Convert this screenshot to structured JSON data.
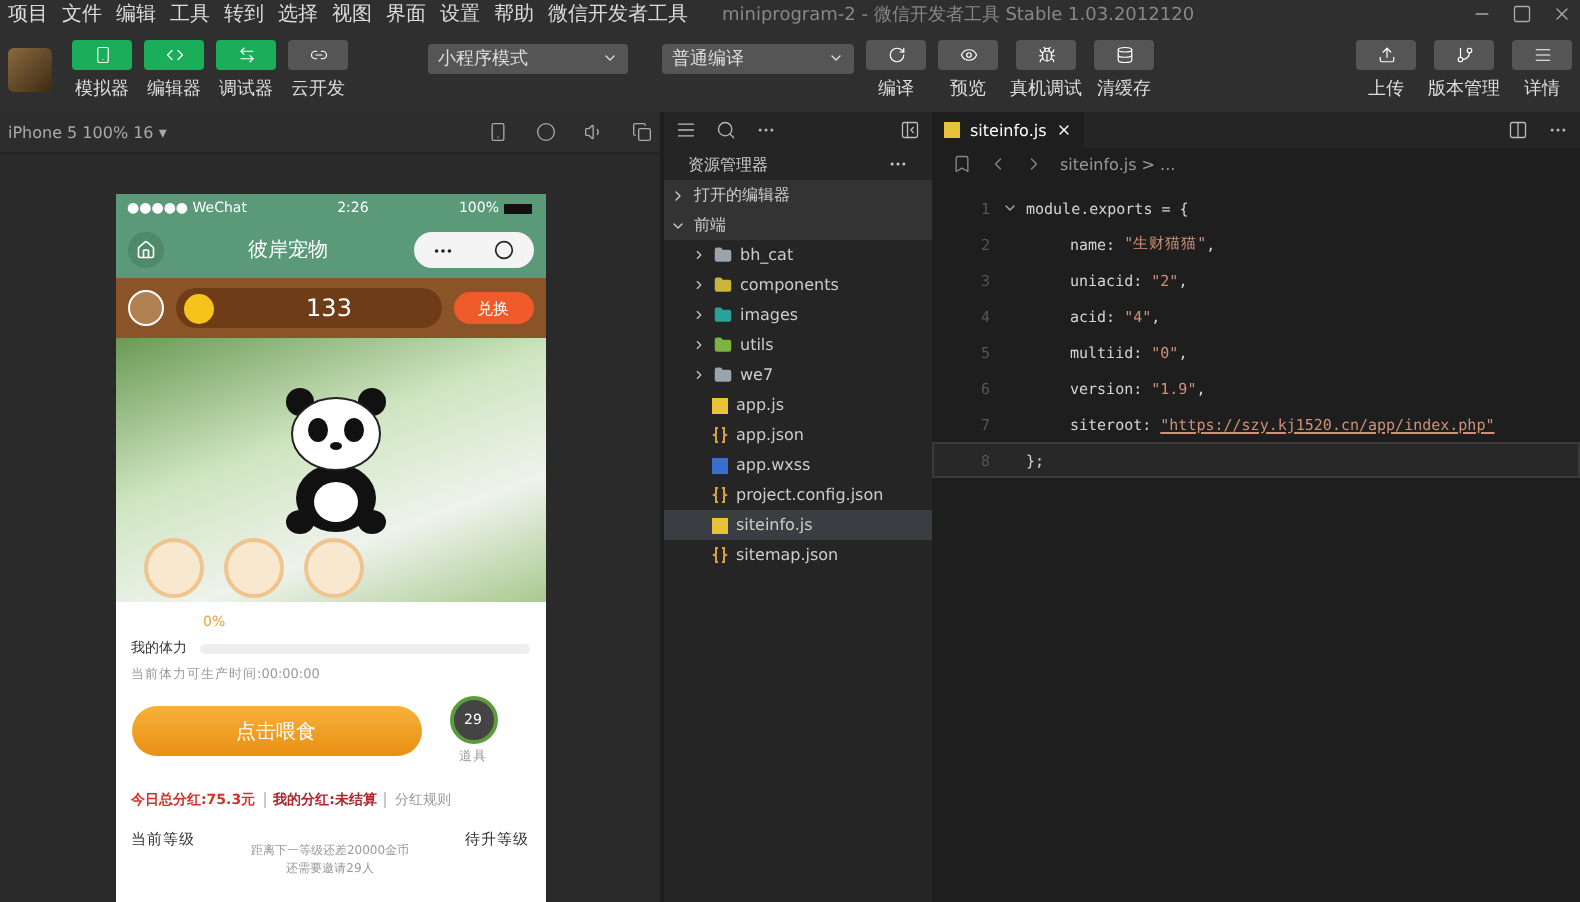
{
  "menu_bar": {
    "items": [
      "项目",
      "文件",
      "编辑",
      "工具",
      "转到",
      "选择",
      "视图",
      "界面",
      "设置",
      "帮助",
      "微信开发者工具"
    ],
    "title": "miniprogram-2 - 微信开发者工具 Stable 1.03.2012120"
  },
  "toolbar": {
    "toggles": [
      {
        "label": "模拟器",
        "on": true
      },
      {
        "label": "编辑器",
        "on": true
      },
      {
        "label": "调试器",
        "on": true
      },
      {
        "label": "云开发",
        "on": false
      }
    ],
    "dropdowns": [
      "小程序模式",
      "普通编译"
    ],
    "actions": [
      "编译",
      "预览",
      "真机调试",
      "清缓存"
    ],
    "right_actions": [
      "上传",
      "版本管理",
      "详情"
    ]
  },
  "simulator": {
    "device": "iPhone 5 100% 16 ▾",
    "phone": {
      "carrier": "●●●●● WeChat",
      "time": "2:26",
      "battery": "100%",
      "title": "彼岸宠物",
      "coins": "133",
      "exchange": "兑换",
      "percent": "0%",
      "stamina_label": "我的体力",
      "stamina": {
        "level": 0
      },
      "stamina_time": "当前体力可生产时间:00:00:00",
      "feed_button": "点击喂食",
      "item_count": "29",
      "item_label": "道具",
      "dividends": [
        {
          "text": "今日总分红:75.3元",
          "kind": "total"
        },
        {
          "text": "我的分红:未结算",
          "kind": "mine"
        },
        {
          "text": "分红规则",
          "kind": "rule"
        }
      ],
      "current_level": "当前等级",
      "next_level": "待升等级",
      "level_note": [
        "距离下一等级还差20000金币",
        "还需要邀请29人"
      ]
    }
  },
  "explorer": {
    "title": "资源管理器",
    "sections": [
      {
        "label": "打开的编辑器",
        "expanded": false
      },
      {
        "label": "前端",
        "expanded": true,
        "children": [
          {
            "name": "bh_cat",
            "kind": "folder",
            "color": "#9aa4ad"
          },
          {
            "name": "components",
            "kind": "folder",
            "color": "#c9b53a"
          },
          {
            "name": "images",
            "kind": "folder",
            "color": "#2aa198"
          },
          {
            "name": "utils",
            "kind": "folder",
            "color": "#7cb342"
          },
          {
            "name": "we7",
            "kind": "folder",
            "color": "#9aa4ad"
          },
          {
            "name": "app.js",
            "kind": "js",
            "selected": false
          },
          {
            "name": "app.json",
            "kind": "json",
            "selected": false
          },
          {
            "name": "app.wxss",
            "kind": "wxss",
            "selected": false
          },
          {
            "name": "project.config.json",
            "kind": "json",
            "selected": false
          },
          {
            "name": "siteinfo.js",
            "kind": "js",
            "selected": true
          },
          {
            "name": "sitemap.json",
            "kind": "json",
            "selected": false
          }
        ]
      }
    ]
  },
  "editor": {
    "tab": "siteinfo.js",
    "breadcrumb": "siteinfo.js > ...",
    "lines": [
      {
        "number": "1",
        "kind": "plain",
        "text": "module.exports = {",
        "current": false
      },
      {
        "number": "2",
        "kind": "prop",
        "key": "name: ",
        "value": "\"生财猫猫\"",
        "tail": ",",
        "current": false
      },
      {
        "number": "3",
        "kind": "prop",
        "key": "uniacid: ",
        "value": "\"2\"",
        "tail": ",",
        "current": false
      },
      {
        "number": "4",
        "kind": "prop",
        "key": "acid: ",
        "value": "\"4\"",
        "tail": ",",
        "current": false
      },
      {
        "number": "5",
        "kind": "prop",
        "key": "multiid: ",
        "value": "\"0\"",
        "tail": ",",
        "current": false
      },
      {
        "number": "6",
        "kind": "prop",
        "key": "version: ",
        "value": "\"1.9\"",
        "tail": ",",
        "current": false
      },
      {
        "number": "7",
        "kind": "url",
        "key": "siteroot: ",
        "value": "\"https://szy.kj1520.cn/app/index.php\"",
        "current": false
      },
      {
        "number": "8",
        "kind": "plain",
        "text": "};",
        "current": true
      }
    ]
  }
}
